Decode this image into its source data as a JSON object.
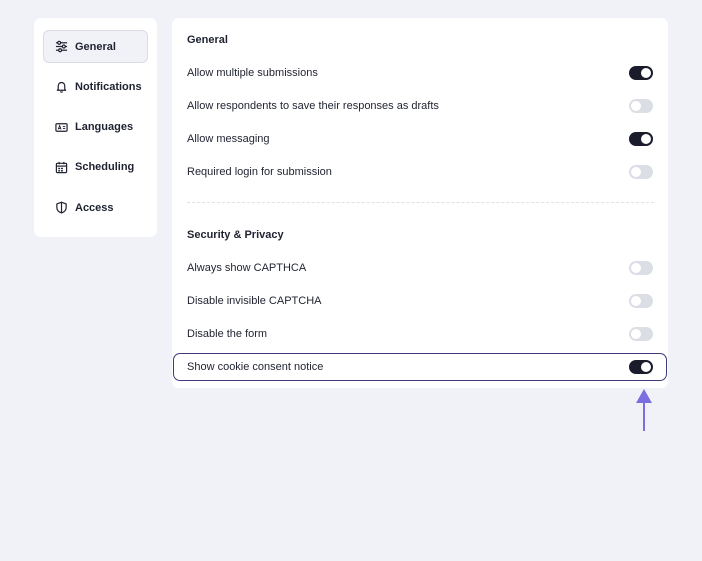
{
  "sidebar": {
    "items": [
      {
        "label": "General",
        "icon": "sliders-icon",
        "active": true
      },
      {
        "label": "Notifications",
        "icon": "bell-icon",
        "active": false
      },
      {
        "label": "Languages",
        "icon": "language-icon",
        "active": false
      },
      {
        "label": "Scheduling",
        "icon": "calendar-icon",
        "active": false
      },
      {
        "label": "Access",
        "icon": "shield-icon",
        "active": false
      }
    ]
  },
  "general": {
    "title": "General",
    "settings": [
      {
        "label": "Allow multiple submissions",
        "enabled": true
      },
      {
        "label": "Allow respondents to save their responses as drafts",
        "enabled": false
      },
      {
        "label": "Allow messaging",
        "enabled": true
      },
      {
        "label": "Required login for submission",
        "enabled": false
      }
    ]
  },
  "security": {
    "title": "Security & Privacy",
    "settings": [
      {
        "label": "Always show CAPTHCA",
        "enabled": false
      },
      {
        "label": "Disable invisible CAPTCHA",
        "enabled": false
      },
      {
        "label": "Disable the form",
        "enabled": false
      },
      {
        "label": "Show cookie consent notice",
        "enabled": true
      }
    ]
  },
  "colors": {
    "background": "#f1f2f7",
    "toggle_on": "#1a1b2b",
    "toggle_off": "#dcdee6",
    "highlight_border": "#3f3a7a",
    "arrow": "#7b6ee0"
  }
}
